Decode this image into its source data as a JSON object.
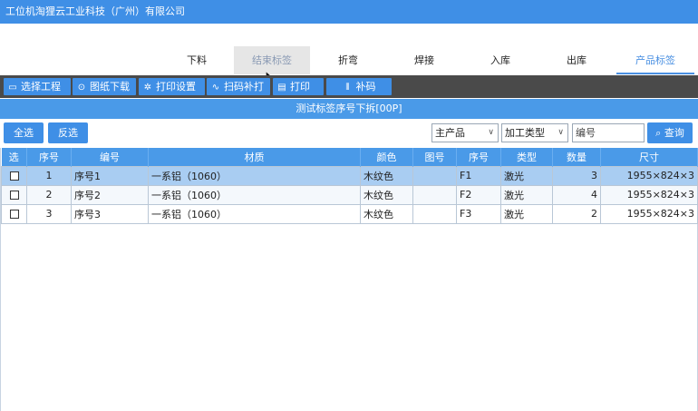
{
  "app": {
    "title": "工位机淘狸云工业科技（广州）有限公司"
  },
  "tabs": [
    {
      "label": "下料"
    },
    {
      "label": "结束标签"
    },
    {
      "label": "折弯"
    },
    {
      "label": "焊接"
    },
    {
      "label": "入库"
    },
    {
      "label": "出库"
    },
    {
      "label": "产品标签"
    }
  ],
  "toolbar": {
    "items": [
      {
        "label": "选择工程",
        "icon": "monitor-icon"
      },
      {
        "label": "图纸下载",
        "icon": "download-icon"
      },
      {
        "label": "打印设置",
        "icon": "gear-icon"
      },
      {
        "label": "扫码补打",
        "icon": "scan-icon"
      },
      {
        "label": "打印",
        "icon": "printer-icon"
      },
      {
        "label": "补码",
        "icon": "barcode-icon"
      }
    ]
  },
  "banner": {
    "text": "测试标签序号下拆[00P]"
  },
  "filter": {
    "select_all": "全选",
    "invert": "反选",
    "product_select": "主产品",
    "process_select": "加工类型",
    "code_placeholder": "编号",
    "search": "查询"
  },
  "table": {
    "headers": [
      "选",
      "序号",
      "编号",
      "材质",
      "颜色",
      "图号",
      "序号",
      "类型",
      "数量",
      "尺寸"
    ],
    "rows": [
      {
        "no": "1",
        "code": "序号1",
        "material": "一系铝（1060）",
        "color": "木纹色",
        "drawing": "",
        "seq": "F1",
        "type": "激光",
        "qty": "3",
        "size": "1955×824×3"
      },
      {
        "no": "2",
        "code": "序号2",
        "material": "一系铝（1060）",
        "color": "木纹色",
        "drawing": "",
        "seq": "F2",
        "type": "激光",
        "qty": "4",
        "size": "1955×824×3"
      },
      {
        "no": "3",
        "code": "序号3",
        "material": "一系铝（1060）",
        "color": "木纹色",
        "drawing": "",
        "seq": "F3",
        "type": "激光",
        "qty": "2",
        "size": "1955×824×3"
      }
    ]
  }
}
